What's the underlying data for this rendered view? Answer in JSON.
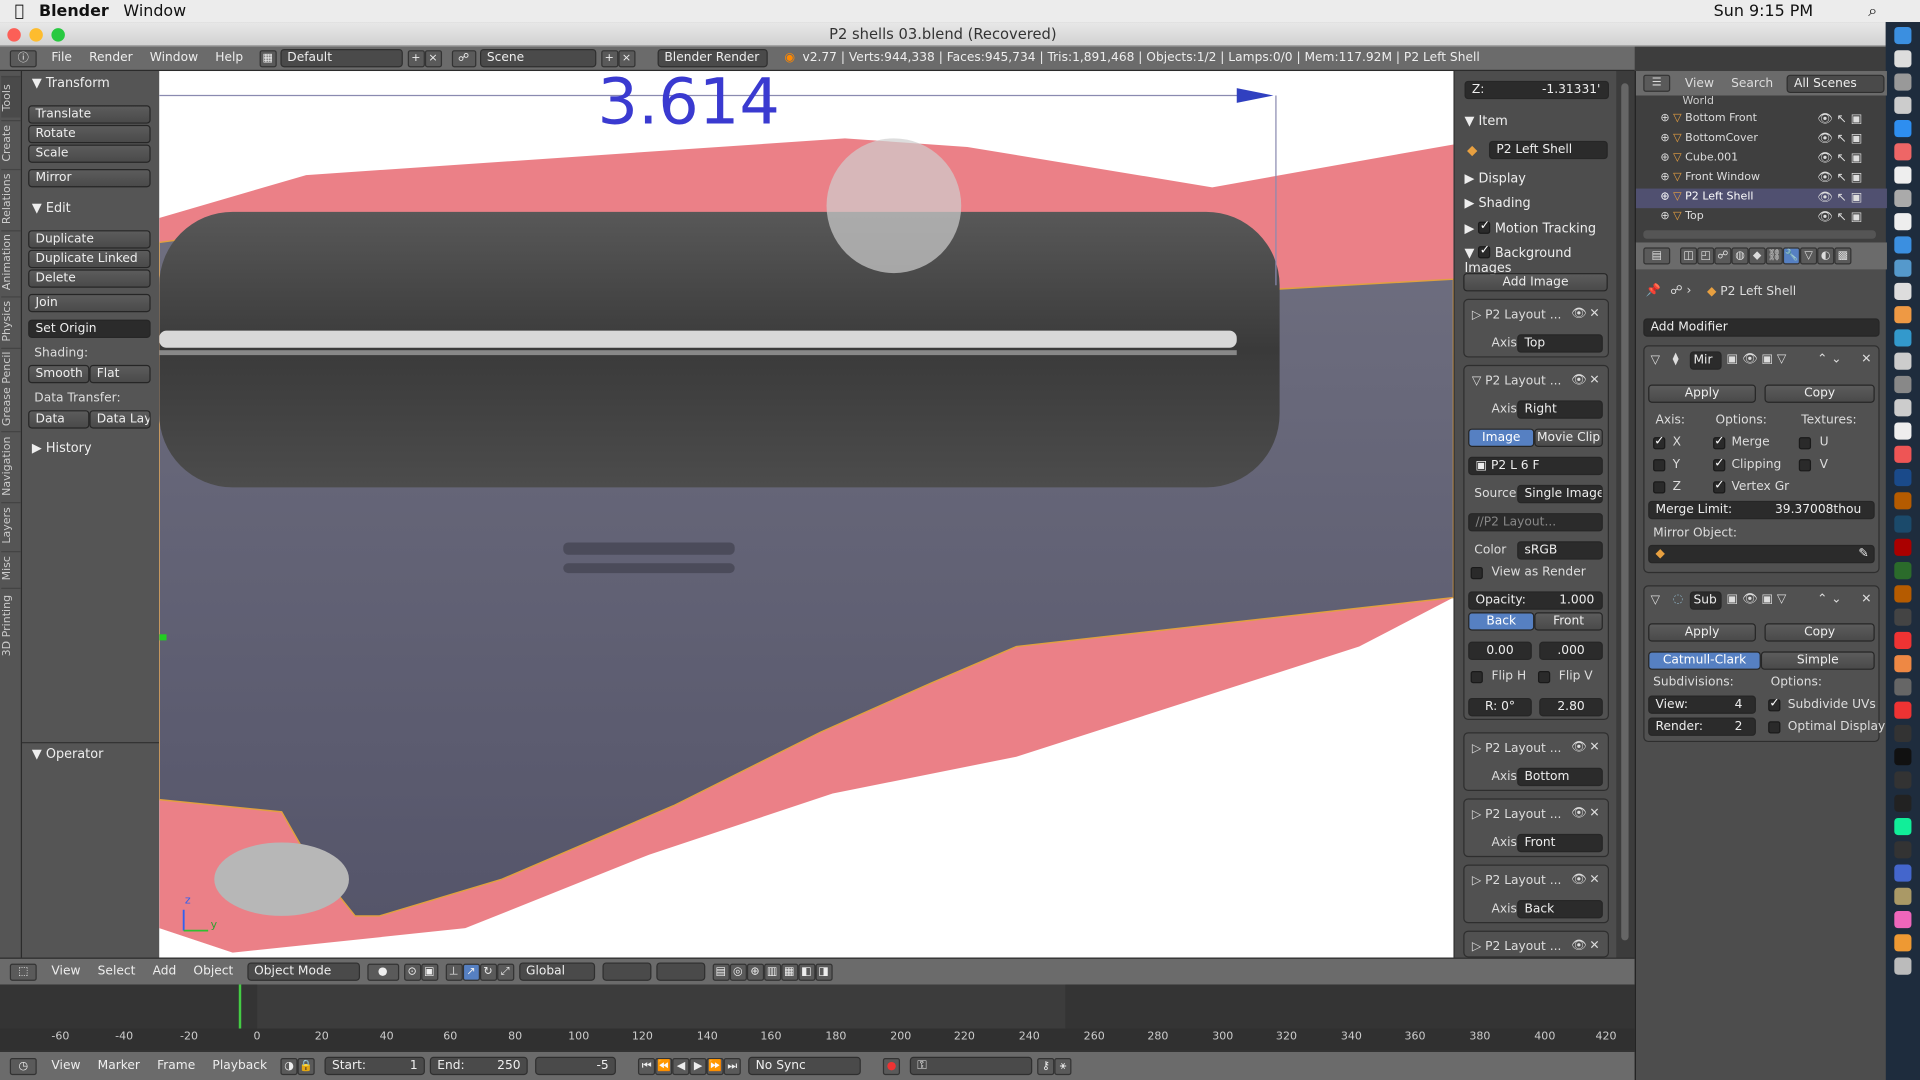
{
  "mac": {
    "app": "Blender",
    "menu": "Window",
    "clock": "Sun 9:15 PM"
  },
  "window": {
    "title": "P2 shells 03.blend (Recovered)"
  },
  "info": {
    "menus": [
      "File",
      "Render",
      "Window",
      "Help"
    ],
    "layout": "Default",
    "scene": "Scene",
    "engine": "Blender Render",
    "stats": "v2.77 | Verts:944,338 | Faces:945,734 | Tris:1,891,468 | Objects:1/2 | Lamps:0/0 | Mem:117.92M | P2 Left Shell"
  },
  "tabs": [
    "Tools",
    "Create",
    "Relations",
    "Animation",
    "Physics",
    "Grease Pencil",
    "Navigation",
    "Layers",
    "Misc",
    "3D Printing"
  ],
  "shelf": {
    "transform": "Transform",
    "translate": "Translate",
    "rotate": "Rotate",
    "scale": "Scale",
    "mirror": "Mirror",
    "edit": "Edit",
    "duplicate": "Duplicate",
    "duplicate_linked": "Duplicate Linked",
    "delete": "Delete",
    "join": "Join",
    "set_origin": "Set Origin",
    "shading": "Shading:",
    "smooth": "Smooth",
    "flat": "Flat",
    "data_transfer": "Data Transfer:",
    "data": "Data",
    "data_layo": "Data Layo",
    "history": "History",
    "operator": "Operator"
  },
  "viewport": {
    "dimension": "3.614",
    "axis_z": "z",
    "axis_y": "y"
  },
  "npanel": {
    "z_label": "Z:",
    "z_value": "-1.31331'",
    "item": "Item",
    "object_name": "P2 Left Shell",
    "display": "Display",
    "shading": "Shading",
    "motion_tracking": "Motion Tracking",
    "background_images": "Background Images",
    "add_image": "Add Image",
    "bg_name": "P2 Layout ...",
    "axis": "Axis:",
    "axes": [
      "Top",
      "Right",
      "Bottom",
      "Front",
      "Back"
    ],
    "image_tab": "Image",
    "movie_clip_tab": "Movie Clip",
    "img_short": "P2 L",
    "img_users": "6",
    "img_f": "F",
    "source": "Source",
    "source_val": "Single Image",
    "path": "//P2 Layout...",
    "color": "Color",
    "color_val": "sRGB",
    "view_as_render": "View as Render",
    "opacity": "Opacity:",
    "opacity_val": "1.000",
    "back": "Back",
    "front": "Front",
    "offx": "0.00",
    "offy": ".000",
    "fliph": "Flip H",
    "flipv": "Flip V",
    "rot": "R: 0°",
    "size": "2.80"
  },
  "outliner": {
    "view": "View",
    "search": "Search",
    "all_scenes": "All Scenes",
    "items": [
      "World",
      "Bottom Front",
      "BottomCover",
      "Cube.001",
      "Front Window",
      "P2 Left Shell",
      "Top"
    ]
  },
  "props": {
    "object": "P2 Left Shell",
    "add_modifier": "Add Modifier",
    "mirror_short": "Mir",
    "apply": "Apply",
    "copy": "Copy",
    "axis": "Axis:",
    "options": "Options:",
    "textures": "Textures:",
    "x": "X",
    "y": "Y",
    "z": "Z",
    "merge": "Merge",
    "clipping": "Clipping",
    "vertex_gr": "Vertex Gr",
    "u": "U",
    "v": "V",
    "merge_limit": "Merge Limit:",
    "merge_limit_val": "39.37008thou",
    "mirror_object": "Mirror Object:",
    "sub_short": "Sub",
    "catmull": "Catmull-Clark",
    "simple": "Simple",
    "subdivisions": "Subdivisions:",
    "view_label": "View:",
    "view_val": "4",
    "render_label": "Render:",
    "render_val": "2",
    "subdivide_uvs": "Subdivide UVs",
    "optimal_display": "Optimal Display"
  },
  "v3dh": {
    "view": "View",
    "select": "Select",
    "add": "Add",
    "object": "Object",
    "mode": "Object Mode",
    "orientation": "Global"
  },
  "timeline": {
    "ticks": [
      "-60",
      "-40",
      "-20",
      "0",
      "20",
      "40",
      "60",
      "80",
      "100",
      "120",
      "140",
      "160",
      "180",
      "200",
      "220",
      "240",
      "260",
      "280",
      "300",
      "320",
      "340",
      "360",
      "380",
      "400",
      "420"
    ],
    "view": "View",
    "marker": "Marker",
    "frame": "Frame",
    "playback": "Playback",
    "start": "Start:",
    "start_val": "1",
    "end": "End:",
    "end_val": "250",
    "current": "-5",
    "sync": "No Sync"
  }
}
